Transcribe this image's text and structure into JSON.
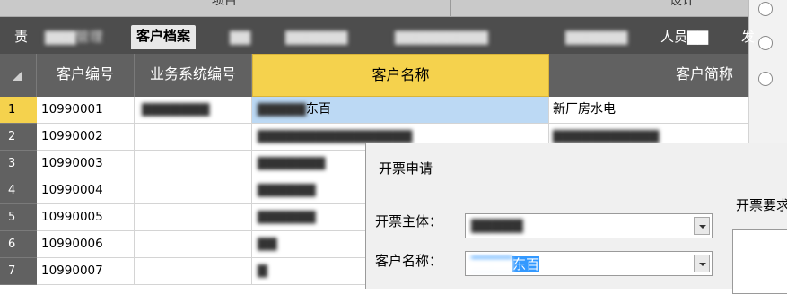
{
  "top_header": {
    "section_project": "项目",
    "section_design": "设计"
  },
  "tabs": [
    {
      "label": "责",
      "blurred": false
    },
    {
      "label": "▇▇▇管理",
      "blurred": true
    },
    {
      "label": "客户档案",
      "blurred": false,
      "active": true
    },
    {
      "label": "▇▇",
      "blurred": true
    },
    {
      "label": "▇▇▇▇▇▇",
      "blurred": true
    },
    {
      "label": "▇▇▇▇▇▇▇▇▇",
      "blurred": true
    },
    {
      "label": "▇▇▇▇▇▇",
      "blurred": true
    },
    {
      "label": "人员▇▇",
      "blurred": true
    },
    {
      "label": "发",
      "blurred": false
    }
  ],
  "grid": {
    "columns": [
      "客户编号",
      "业务系统编号",
      "客户名称",
      "客户简称"
    ],
    "rows": [
      {
        "num": "1",
        "id": "10990001",
        "sys": "▇▇▇▇▇▇▇",
        "name_blur": "▇▇▇▇▇",
        "name_tail": "东百",
        "short": "新厂房水电"
      },
      {
        "num": "2",
        "id": "10990002",
        "sys": "",
        "name_blur": "▇▇▇▇▇▇▇▇▇▇▇▇▇▇▇▇",
        "name_tail": "",
        "short": "▇▇▇▇▇▇▇▇▇▇▇"
      },
      {
        "num": "3",
        "id": "10990003",
        "sys": "",
        "name_blur": "▇▇▇▇▇▇▇",
        "name_tail": "",
        "short": ""
      },
      {
        "num": "4",
        "id": "10990004",
        "sys": "",
        "name_blur": "▇▇▇▇▇▇",
        "name_tail": "",
        "short": ""
      },
      {
        "num": "5",
        "id": "10990005",
        "sys": "",
        "name_blur": "▇▇▇▇▇▇",
        "name_tail": "",
        "short": ""
      },
      {
        "num": "6",
        "id": "10990006",
        "sys": "",
        "name_blur": "▇▇",
        "name_tail": "",
        "short": ""
      },
      {
        "num": "7",
        "id": "10990007",
        "sys": "",
        "name_blur": "▇",
        "name_tail": "",
        "short": ""
      }
    ]
  },
  "dialog": {
    "title": "开票申请",
    "label_subject": "开票主体：",
    "subject_value": "▇▇▇▇▇",
    "label_customer": "客户名称：",
    "customer_blur": "▇▇▇▇",
    "customer_tail": "东百",
    "label_requirement": "开票要求"
  },
  "colors": {
    "tab_bar": "#4d4d4d",
    "grid_header": "#616161",
    "selected_column": "#f5d24d",
    "highlight_cell": "#bcd9f4",
    "selection": "#3399ff"
  }
}
